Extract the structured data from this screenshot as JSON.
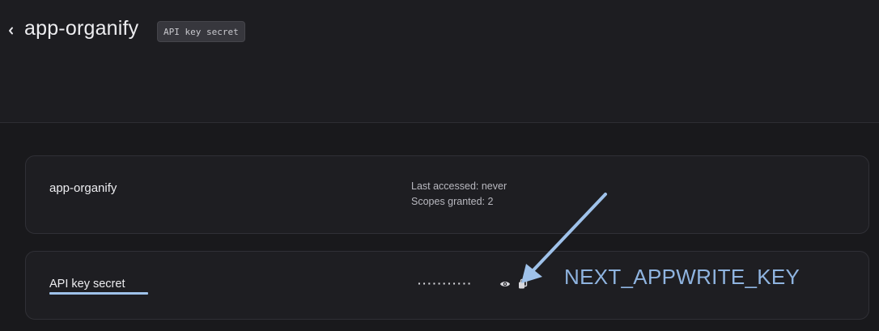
{
  "header": {
    "title": "app-organify",
    "tag": "API key secret"
  },
  "key_card": {
    "name": "app-organify",
    "last_accessed": "Last accessed: never",
    "scopes_granted": "Scopes granted: 2"
  },
  "secret_card": {
    "label": "API key secret",
    "masked_value": "···········"
  },
  "annotation": {
    "text": "NEXT_APPWRITE_KEY",
    "color": "#8fb4e0"
  },
  "icons": [
    "chevron-left-icon",
    "eye-icon",
    "copy-icon"
  ]
}
